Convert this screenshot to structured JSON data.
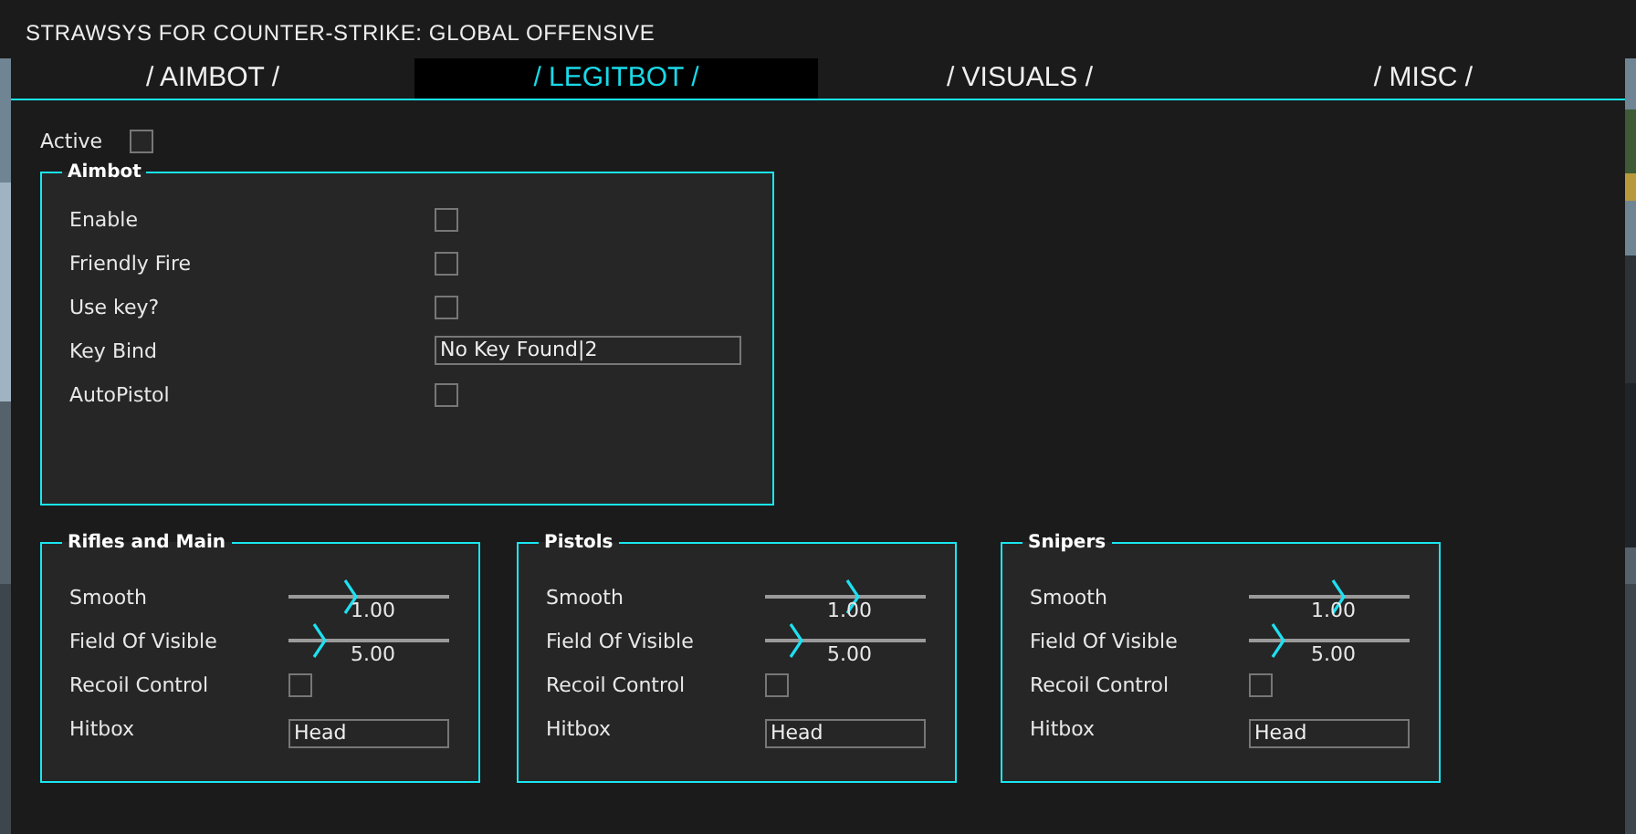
{
  "window": {
    "title": "STRAWSYS FOR COUNTER-STRIKE: GLOBAL OFFENSIVE"
  },
  "tabs": [
    {
      "label": "/ AIMBOT /",
      "selected": false
    },
    {
      "label": "/ LEGITBOT /",
      "selected": true
    },
    {
      "label": "/ VISUALS /",
      "selected": false
    },
    {
      "label": "/ MISC /",
      "selected": false
    }
  ],
  "active": {
    "label": "Active",
    "checked": false
  },
  "aimbot": {
    "title": "Aimbot",
    "rows": [
      {
        "kind": "checkbox",
        "label": "Enable",
        "checked": false
      },
      {
        "kind": "checkbox",
        "label": "Friendly Fire",
        "checked": false
      },
      {
        "kind": "checkbox",
        "label": "Use key?",
        "checked": false
      },
      {
        "kind": "field",
        "label": "Key Bind",
        "value": "No Key Found|2"
      },
      {
        "kind": "checkbox",
        "label": "AutoPistol",
        "checked": false
      }
    ]
  },
  "groups": [
    {
      "title": "Rifles and Main",
      "rows": [
        {
          "kind": "slider",
          "label": "Smooth",
          "level": 0.39,
          "reading": "1.00"
        },
        {
          "kind": "slider",
          "label": "Field Of Visible",
          "level": 0.19,
          "reading": "5.00"
        },
        {
          "kind": "checkbox",
          "label": "Recoil Control",
          "checked": false
        },
        {
          "kind": "field",
          "label": "Hitbox",
          "value": "Head"
        }
      ]
    },
    {
      "title": "Pistols",
      "rows": [
        {
          "kind": "slider",
          "label": "Smooth",
          "level": 0.55,
          "reading": "1.00"
        },
        {
          "kind": "slider",
          "label": "Field Of Visible",
          "level": 0.19,
          "reading": "5.00"
        },
        {
          "kind": "checkbox",
          "label": "Recoil Control",
          "checked": false
        },
        {
          "kind": "field",
          "label": "Hitbox",
          "value": "Head"
        }
      ]
    },
    {
      "title": "Snipers",
      "rows": [
        {
          "kind": "slider",
          "label": "Smooth",
          "level": 0.56,
          "reading": "1.00"
        },
        {
          "kind": "slider",
          "label": "Field Of Visible",
          "level": 0.18,
          "reading": "5.00"
        },
        {
          "kind": "checkbox",
          "label": "Recoil Control",
          "checked": false
        },
        {
          "kind": "field",
          "label": "Hitbox",
          "value": "Head"
        }
      ]
    }
  ]
}
